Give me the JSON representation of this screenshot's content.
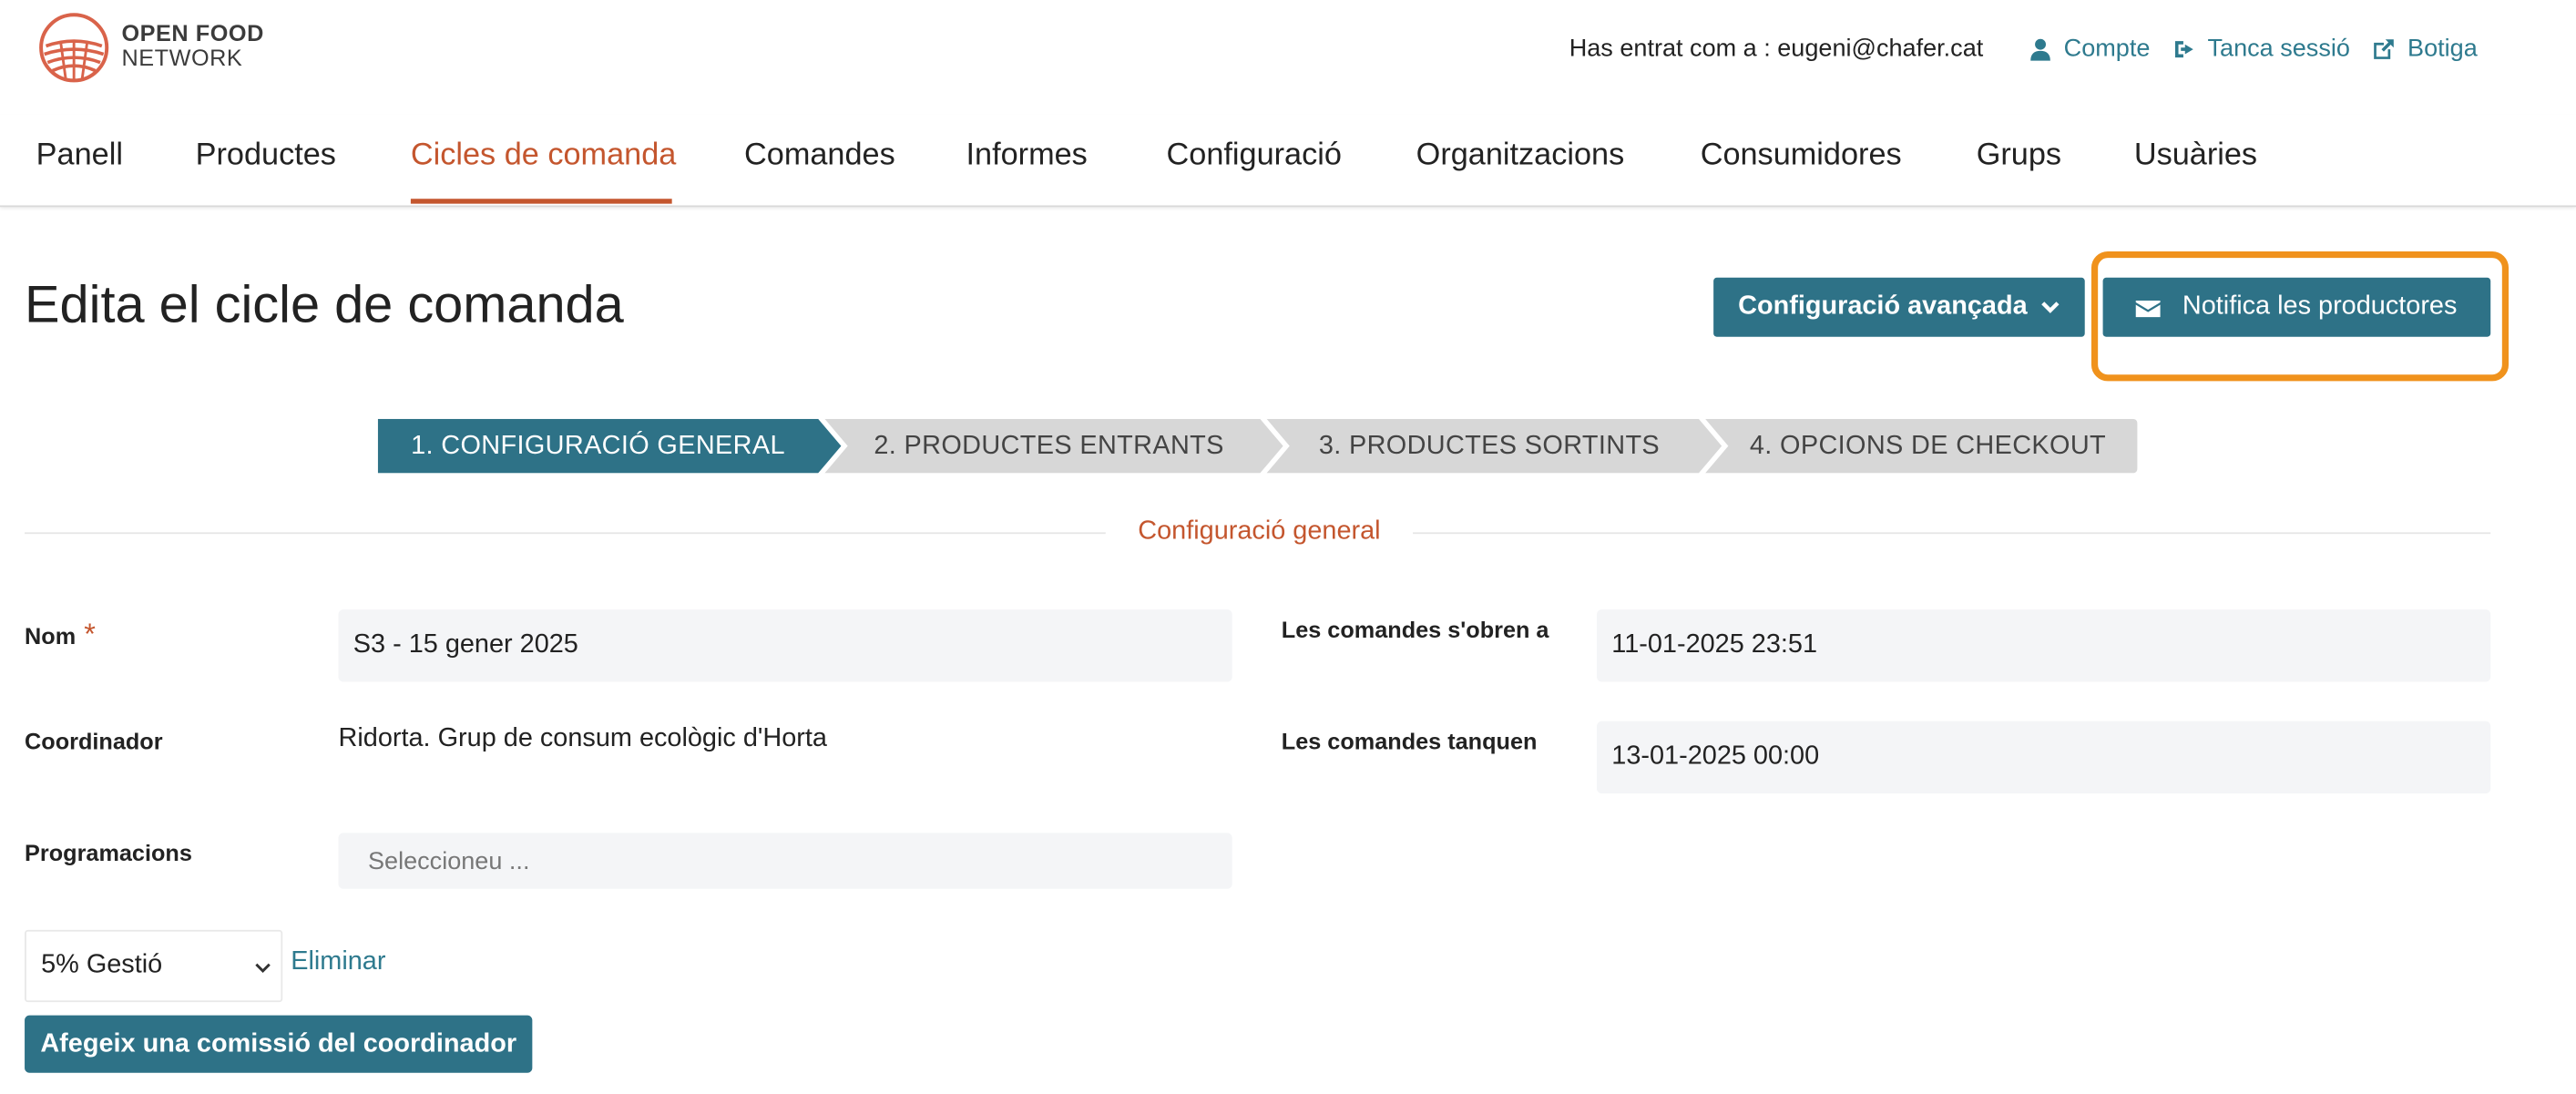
{
  "header": {
    "logo_line1": "OPEN FOOD",
    "logo_line2": "NETWORK",
    "logged_in_text": "Has entrat com a : eugeni@chafer.cat",
    "account_label": "Compte",
    "logout_label": "Tanca sessió",
    "shop_label": "Botiga"
  },
  "nav": {
    "items": [
      "Panell",
      "Productes",
      "Cicles de comanda",
      "Comandes",
      "Informes",
      "Configuració",
      "Organitzacions",
      "Consumidores",
      "Grups",
      "Usuàries"
    ],
    "active": "Cicles de comanda"
  },
  "page": {
    "title": "Edita el cicle de comanda",
    "advanced_settings_label": "Configuració avançada",
    "notify_producers_label": "Notifica les productores"
  },
  "wizard": {
    "steps": [
      "1. CONFIGURACIÓ GENERAL",
      "2. PRODUCTES ENTRANTS",
      "3. PRODUCTES SORTINTS",
      "4. OPCIONS DE CHECKOUT"
    ],
    "active_step": 1
  },
  "form": {
    "section_title": "Configuració general",
    "name_label": "Nom",
    "name_required_mark": "*",
    "name_value": "S3 - 15 gener 2025",
    "coordinator_label": "Coordinador",
    "coordinator_value": "Ridorta. Grup de consum ecològic d'Horta",
    "schedules_label": "Programacions",
    "schedules_placeholder": "Seleccioneu ...",
    "opens_label": "Les comandes s'obren a",
    "opens_value": "11-01-2025 23:51",
    "closes_label": "Les comandes tanquen",
    "closes_value": "13-01-2025 00:00",
    "fee_selected": "5% Gestió",
    "remove_label": "Eliminar",
    "add_fee_label": "Afegeix una comissió del coordinador"
  },
  "colors": {
    "brand_orange": "#c4562e",
    "primary_teal": "#2e7287",
    "link_teal": "#2e7a8e",
    "highlight_orange": "#f0921c",
    "step_inactive": "#d7d7d7"
  }
}
